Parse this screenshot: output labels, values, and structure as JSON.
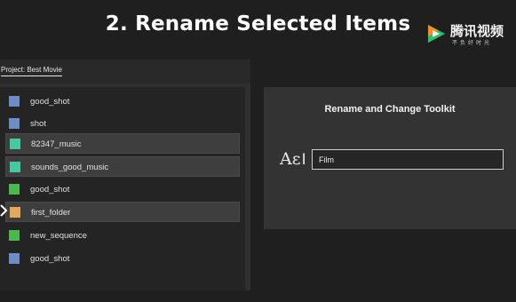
{
  "title": "2. Rename Selected Items",
  "watermark": {
    "brand": "腾讯视频",
    "tagline": "不负好时光",
    "icon": "tencent-video-logo"
  },
  "project": {
    "tab_label": "Project: Best Movie",
    "items": [
      {
        "label": "good_shot",
        "color": "#6e8cc7",
        "selected": false
      },
      {
        "label": "shot",
        "color": "#6e8cc7",
        "selected": false
      },
      {
        "label": "82347_music",
        "color": "#45c9a0",
        "selected": true
      },
      {
        "label": "sounds_good_music",
        "color": "#45c9a0",
        "selected": true
      },
      {
        "label": "good_shot",
        "color": "#4ab84d",
        "selected": false
      },
      {
        "label": "first_folder",
        "color": "#e3a85a",
        "selected": true
      },
      {
        "label": "new_sequence",
        "color": "#4ab84d",
        "selected": false
      },
      {
        "label": "good_shot",
        "color": "#6e8cc7",
        "selected": false
      }
    ]
  },
  "toolkit": {
    "title": "Rename and Change Toolkit",
    "icon_glyph": "Aε",
    "icon_cursor": "I",
    "icon": "rename-text-icon",
    "input_value": "Film"
  },
  "icons": {
    "pointer": "chevron-right-icon"
  }
}
